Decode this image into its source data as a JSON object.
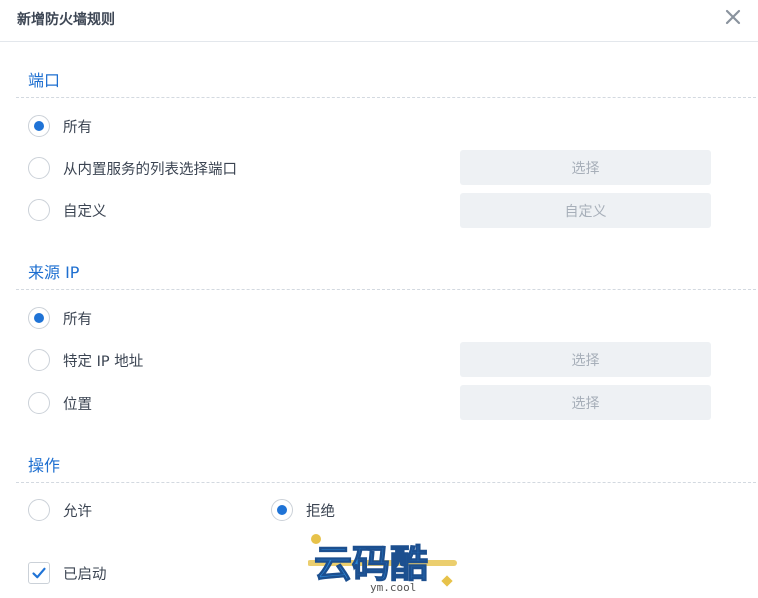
{
  "dialog": {
    "title": "新增防火墙规则",
    "close_icon": "close-icon"
  },
  "port": {
    "title": "端口",
    "options": [
      {
        "label": "所有",
        "checked": true
      },
      {
        "label": "从内置服务的列表选择端口",
        "checked": false,
        "button": "选择"
      },
      {
        "label": "自定义",
        "checked": false,
        "button": "自定义"
      }
    ]
  },
  "source_ip": {
    "title": "来源 IP",
    "options": [
      {
        "label": "所有",
        "checked": true
      },
      {
        "label": "特定 IP 地址",
        "checked": false,
        "button": "选择"
      },
      {
        "label": "位置",
        "checked": false,
        "button": "选择"
      }
    ]
  },
  "action": {
    "title": "操作",
    "options": [
      {
        "label": "允许",
        "checked": false
      },
      {
        "label": "拒绝",
        "checked": true
      }
    ]
  },
  "enabled": {
    "label": "已启动",
    "checked": true
  },
  "watermark": {
    "main": "云码酷",
    "sub": "ym.cool"
  },
  "colors": {
    "accent": "#1f73d6",
    "section_title": "#1e6fd0",
    "button_bg": "#eef1f4",
    "button_text": "#a7afb9"
  }
}
